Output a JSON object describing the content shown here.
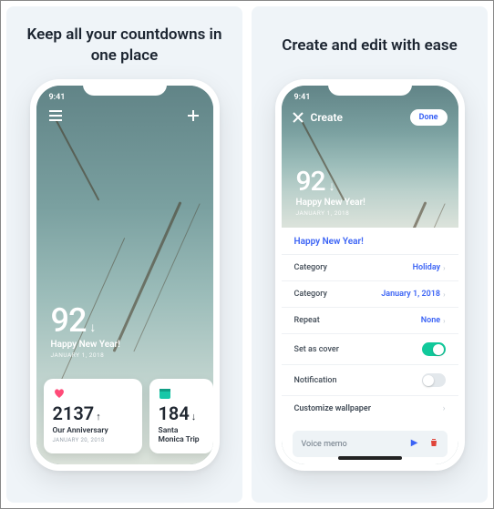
{
  "left": {
    "headline": "Keep all your countdowns in one place",
    "status_time": "9:41",
    "main_event": {
      "number": "92",
      "direction": "↓",
      "title": "Happy New Year!",
      "date": "JANUARY 1, 2018"
    },
    "cards": [
      {
        "icon": "heart",
        "number": "2137",
        "direction": "↑",
        "title": "Our Anniversary",
        "date": "JANUARY 20, 2018"
      },
      {
        "icon": "calendar",
        "number": "184",
        "direction": "↓",
        "title": "Santa Monica Trip",
        "date": ""
      }
    ]
  },
  "right": {
    "headline": "Create and edit with ease",
    "status_time": "9:41",
    "nav": {
      "title": "Create",
      "done": "Done"
    },
    "preview": {
      "number": "92",
      "direction": "↓",
      "title": "Happy New Year!",
      "date": "JANUARY 1, 2018"
    },
    "input": "Happy New Year!",
    "rows": {
      "category": {
        "label": "Category",
        "value": "Holiday"
      },
      "date": {
        "label": "Category",
        "value": "January 1, 2018"
      },
      "repeat": {
        "label": "Repeat",
        "value": "None"
      },
      "cover": {
        "label": "Set as cover",
        "toggle": true
      },
      "notif": {
        "label": "Notification",
        "toggle": false
      },
      "wallpaper": {
        "label": "Customize wallpaper"
      }
    },
    "voice_memo": "Voice memo"
  }
}
